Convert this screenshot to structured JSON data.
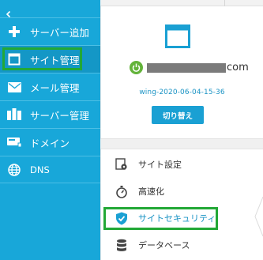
{
  "sidebar": {
    "collapse_icon": "chevron-left-icon",
    "items": [
      {
        "label": "サーバー追加",
        "icon": "plus-icon"
      },
      {
        "label": "サイト管理",
        "icon": "window-icon"
      },
      {
        "label": "メール管理",
        "icon": "envelope-icon"
      },
      {
        "label": "サーバー管理",
        "icon": "server-icon"
      },
      {
        "label": "ドメイン",
        "icon": "domain-card-icon"
      },
      {
        "label": "DNS",
        "icon": "globe-icon"
      }
    ],
    "active_index": 1
  },
  "site": {
    "icon": "browser-window-icon",
    "status_icon": "power-icon",
    "domain_suffix": "com",
    "site_id": "wing-2020-06-04-15-36",
    "switch_label": "切り替え"
  },
  "menu": {
    "items": [
      {
        "label": "サイト設定",
        "icon": "gear-page-icon"
      },
      {
        "label": "高速化",
        "icon": "stopwatch-icon"
      },
      {
        "label": "サイトセキュリティ",
        "icon": "shield-check-icon"
      },
      {
        "label": "データベース",
        "icon": "database-icon"
      }
    ],
    "highlighted_index": 2
  },
  "colors": {
    "sidebar_bg": "#18a7d9",
    "active_bg": "#1497c6",
    "accent_blue": "#1a93c4",
    "highlight_green": "#22a836",
    "power_green": "#63b33a"
  }
}
